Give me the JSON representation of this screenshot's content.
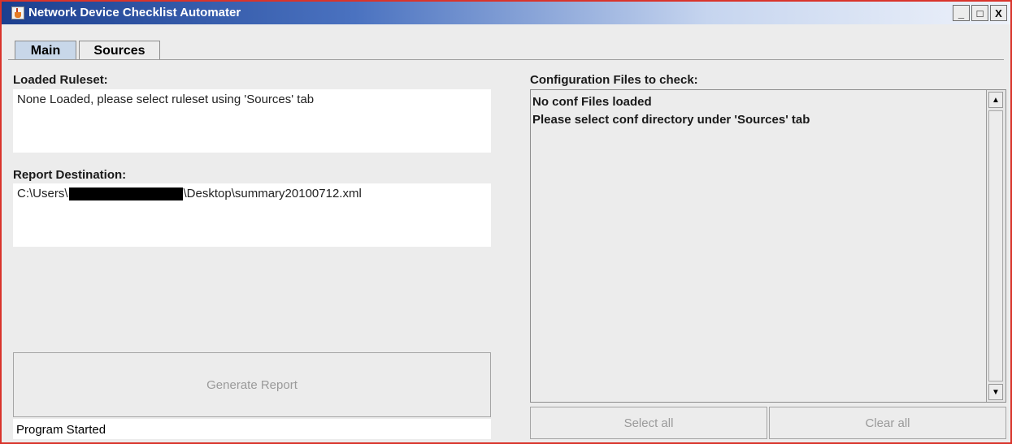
{
  "window": {
    "title": "Network Device Checklist Automater",
    "buttons": {
      "minimize": "_",
      "maximize": "□",
      "close": "X"
    }
  },
  "tabs": [
    {
      "label": "Main"
    },
    {
      "label": "Sources"
    }
  ],
  "ruleset": {
    "label": "Loaded Ruleset:",
    "value": "None Loaded, please select ruleset using 'Sources' tab"
  },
  "report": {
    "label": "Report Destination:",
    "path_prefix": "C:\\Users\\",
    "path_suffix": "\\Desktop\\summary20100712.xml"
  },
  "generate_label": "Generate Report",
  "status_text": "Program Started",
  "conf": {
    "label": "Configuration Files to check:",
    "lines": [
      "No conf Files loaded",
      "Please select conf directory under 'Sources' tab"
    ]
  },
  "select_all_label": "Select all",
  "clear_all_label": "Clear all",
  "colors": {
    "window_border": "#d9342b",
    "titlebar_start": "#1c3f8f",
    "selected_tab": "#c8d7e9",
    "panel": "#ececec"
  }
}
